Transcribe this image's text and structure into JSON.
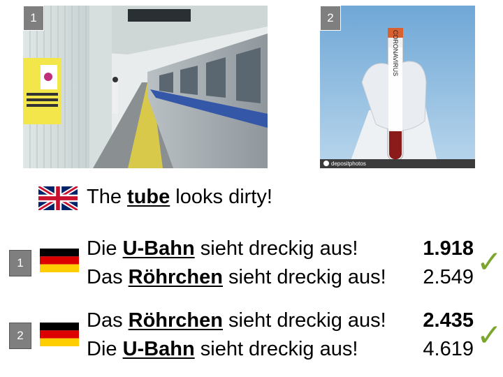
{
  "images": [
    {
      "badge": "1"
    },
    {
      "badge": "2",
      "vial_text": "CORONAVIRUS",
      "watermark": "depositphotos"
    }
  ],
  "english": {
    "flag": "uk-flag-icon",
    "before": "The ",
    "term": "tube",
    "after": " looks dirty!"
  },
  "groups": [
    {
      "badge": "1",
      "flag": "germany-flag-icon",
      "rows": [
        {
          "before": "Die ",
          "term": "U-Bahn",
          "after": " sieht dreckig aus!",
          "score": "1.918",
          "best": true
        },
        {
          "before": "Das ",
          "term": "Röhrchen",
          "after": " sieht dreckig aus!",
          "score": "2.549",
          "best": false
        }
      ]
    },
    {
      "badge": "2",
      "flag": "germany-flag-icon",
      "rows": [
        {
          "before": "Das ",
          "term": "Röhrchen",
          "after": " sieht dreckig aus!",
          "score": "2.435",
          "best": true
        },
        {
          "before": "Die ",
          "term": "U-Bahn",
          "after": " sieht dreckig aus!",
          "score": "4.619",
          "best": false
        }
      ]
    }
  ],
  "check_mark": "✓",
  "colors": {
    "badge": "#7f7f7f",
    "check": "#7aa62e",
    "de_black": "#000000",
    "de_red": "#dd0000",
    "de_gold": "#ffce00"
  }
}
